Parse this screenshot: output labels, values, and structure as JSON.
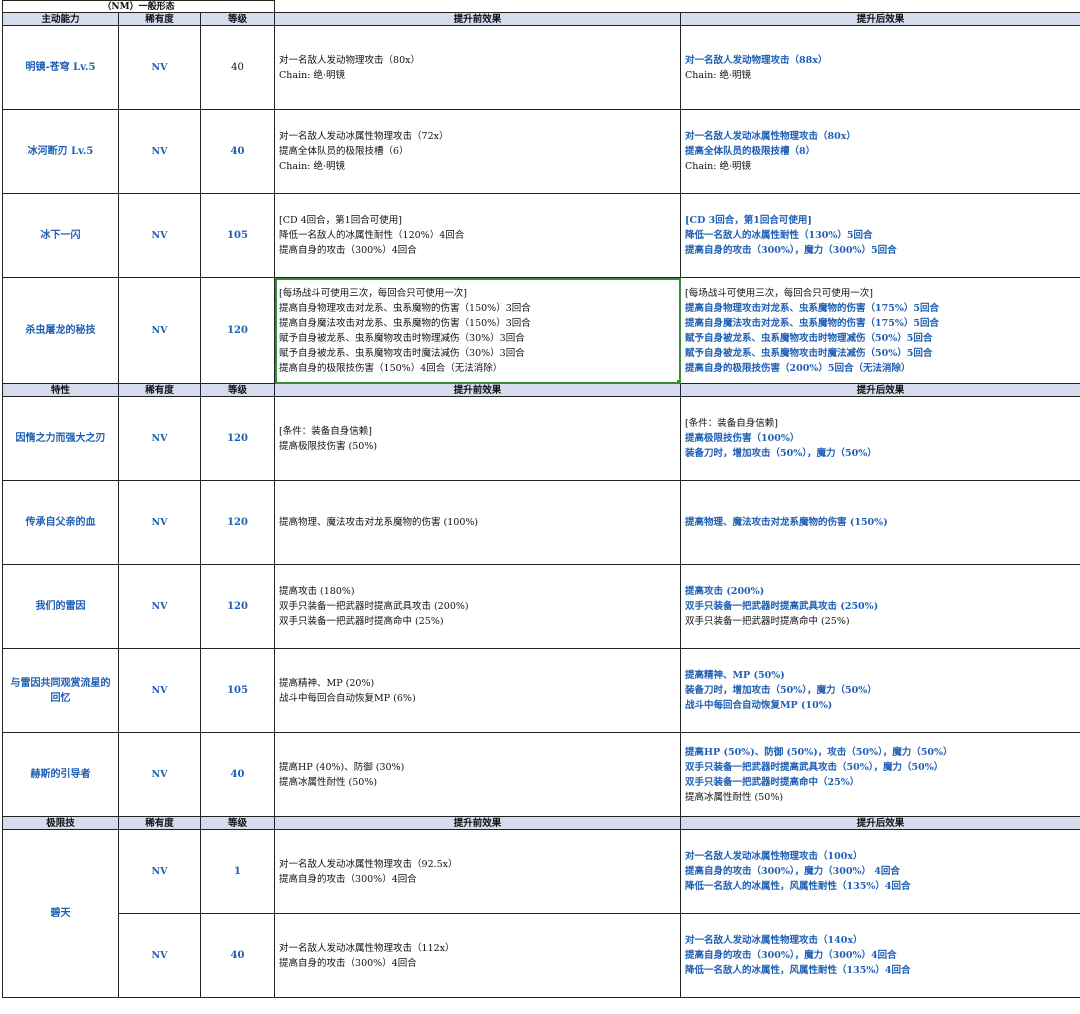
{
  "title": "（NM）一般形态",
  "sections": [
    {
      "headers": [
        "主动能力",
        "稀有度",
        "等级",
        "提升前效果",
        "提升后效果"
      ],
      "rows": [
        {
          "name": "明镜-苍穹 Lv.5",
          "rarity": "NV",
          "level": "40",
          "before": [
            "对一名敌人发动物理攻击（80x）",
            "Chain: 绝·明镜"
          ],
          "after": [
            {
              "t": "对一名敌人发动物理攻击（88x）",
              "b": true
            },
            {
              "t": "Chain: 绝·明镜",
              "b": false
            }
          ]
        },
        {
          "name": "冰河断刃 Lv.5",
          "rarity": "NV",
          "level": "40",
          "before": [
            "对一名敌人发动冰属性物理攻击（72x）",
            "提高全体队员的极限技槽（6）",
            "Chain: 绝·明镜"
          ],
          "after": [
            {
              "t": "对一名敌人发动冰属性物理攻击（80x）",
              "b": true
            },
            {
              "t": "提高全体队员的极限技槽（8）",
              "b": true
            },
            {
              "t": "Chain: 绝·明镜",
              "b": false
            }
          ]
        },
        {
          "name": "冰下一闪",
          "rarity": "NV",
          "level": "105",
          "before": [
            "[CD 4回合，第1回合可使用]",
            "降低一名敌人的冰属性耐性（120%）4回合",
            "提高自身的攻击（300%）4回合"
          ],
          "after": [
            {
              "t": "[CD 3回合，第1回合可使用]",
              "b": true
            },
            {
              "t": "降低一名敌人的冰属性耐性（130%）5回合",
              "b": true
            },
            {
              "t": "提高自身的攻击（300%），魔力（300%）5回合",
              "b": true
            }
          ]
        },
        {
          "name": "杀虫屠龙的秘技",
          "rarity": "NV",
          "level": "120",
          "before": [
            "[每场战斗可使用三次，每回合只可使用一次]",
            "提高自身物理攻击对龙系、虫系魔物的伤害（150%）3回合",
            "提高自身魔法攻击对龙系、虫系魔物的伤害（150%）3回合",
            "赋予自身被龙系、虫系魔物攻击时物理减伤（30%）3回合",
            "赋予自身被龙系、虫系魔物攻击时魔法减伤（30%）3回合",
            "提高自身的极限技伤害（150%）4回合（无法消除）"
          ],
          "after": [
            {
              "t": "[每场战斗可使用三次，每回合只可使用一次]",
              "b": false
            },
            {
              "t": "提高自身物理攻击对龙系、虫系魔物的伤害（175%）5回合",
              "b": true
            },
            {
              "t": "提高自身魔法攻击对龙系、虫系魔物的伤害（175%）5回合",
              "b": true
            },
            {
              "t": "赋予自身被龙系、虫系魔物攻击时物理减伤（50%）5回合",
              "b": true
            },
            {
              "t": "赋予自身被龙系、虫系魔物攻击时魔法减伤（50%）5回合",
              "b": true
            },
            {
              "t": "提高自身的极限技伤害（200%）5回合（无法消除）",
              "b": true
            }
          ]
        }
      ]
    },
    {
      "headers": [
        "特性",
        "稀有度",
        "等级",
        "提升前效果",
        "提升后效果"
      ],
      "rows": [
        {
          "name": "因惰之力而强大之刃",
          "rarity": "NV",
          "level": "120",
          "before": [
            "[条件：装备自身信赖]",
            "提高极限技伤害 (50%)"
          ],
          "after": [
            {
              "t": "[条件：装备自身信赖]",
              "b": false
            },
            {
              "t": "提高极限技伤害（100%）",
              "b": true
            },
            {
              "t": "装备刀时，增加攻击（50%），魔力（50%）",
              "b": true
            }
          ]
        },
        {
          "name": "传承自父亲的血",
          "rarity": "NV",
          "level": "120",
          "before": [
            "提高物理、魔法攻击对龙系魔物的伤害 (100%)"
          ],
          "after": [
            {
              "t": "提高物理、魔法攻击对龙系魔物的伤害 (150%)",
              "b": true
            }
          ]
        },
        {
          "name": "我们的雷因",
          "rarity": "NV",
          "level": "120",
          "before": [
            "提高攻击 (180%)",
            "双手只装备一把武器时提高武具攻击 (200%)",
            "双手只装备一把武器时提高命中 (25%)"
          ],
          "after": [
            {
              "t": "提高攻击 (200%)",
              "b": true
            },
            {
              "t": "双手只装备一把武器时提高武具攻击 (250%)",
              "b": true
            },
            {
              "t": "双手只装备一把武器时提高命中 (25%)",
              "b": false
            }
          ]
        },
        {
          "name": "与雷因共同观赏流星的回忆",
          "rarity": "NV",
          "level": "105",
          "before": [
            "提高精神、MP (20%)",
            "战斗中每回合自动恢复MP (6%)"
          ],
          "after": [
            {
              "t": "提高精神、MP (50%)",
              "b": true
            },
            {
              "t": "装备刀时，增加攻击（50%），魔力（50%）",
              "b": true
            },
            {
              "t": "战斗中每回合自动恢复MP (10%)",
              "b": true
            }
          ]
        },
        {
          "name": "赫斯的引导者",
          "rarity": "NV",
          "level": "40",
          "before": [
            "提高HP (40%)、防御 (30%)",
            "提高冰属性耐性 (50%)"
          ],
          "after": [
            {
              "t": "提高HP (50%)、防御 (50%)，攻击（50%），魔力（50%）",
              "b": true
            },
            {
              "t": "双手只装备一把武器时提高武具攻击（50%），魔力（50%）",
              "b": true
            },
            {
              "t": "双手只装备一把武器时提高命中（25%）",
              "b": true
            },
            {
              "t": "提高冰属性耐性 (50%)",
              "b": false
            }
          ]
        }
      ]
    },
    {
      "headers": [
        "极限技",
        "稀有度",
        "等级",
        "提升前效果",
        "提升后效果"
      ],
      "shared_name": "碧天",
      "rows": [
        {
          "rarity": "NV",
          "level": "1",
          "before": [
            "对一名敌人发动冰属性物理攻击（92.5x）",
            "提高自身的攻击（300%）4回合"
          ],
          "after": [
            {
              "t": "对一名敌人发动冰属性物理攻击（100x）",
              "b": true
            },
            {
              "t": "提高自身的攻击（300%），魔力（300%） 4回合",
              "b": true
            },
            {
              "t": "降低一名敌人的冰属性，风属性耐性（135%）4回合",
              "b": true
            }
          ]
        },
        {
          "rarity": "NV",
          "level": "40",
          "before": [
            "对一名敌人发动冰属性物理攻击（112x）",
            "提高自身的攻击（300%）4回合"
          ],
          "after": [
            {
              "t": "对一名敌人发动冰属性物理攻击（140x）",
              "b": true
            },
            {
              "t": "提高自身的攻击（300%），魔力（300%）4回合",
              "b": true
            },
            {
              "t": "降低一名敌人的冰属性，风属性耐性（135%）4回合",
              "b": true
            }
          ]
        }
      ]
    }
  ]
}
